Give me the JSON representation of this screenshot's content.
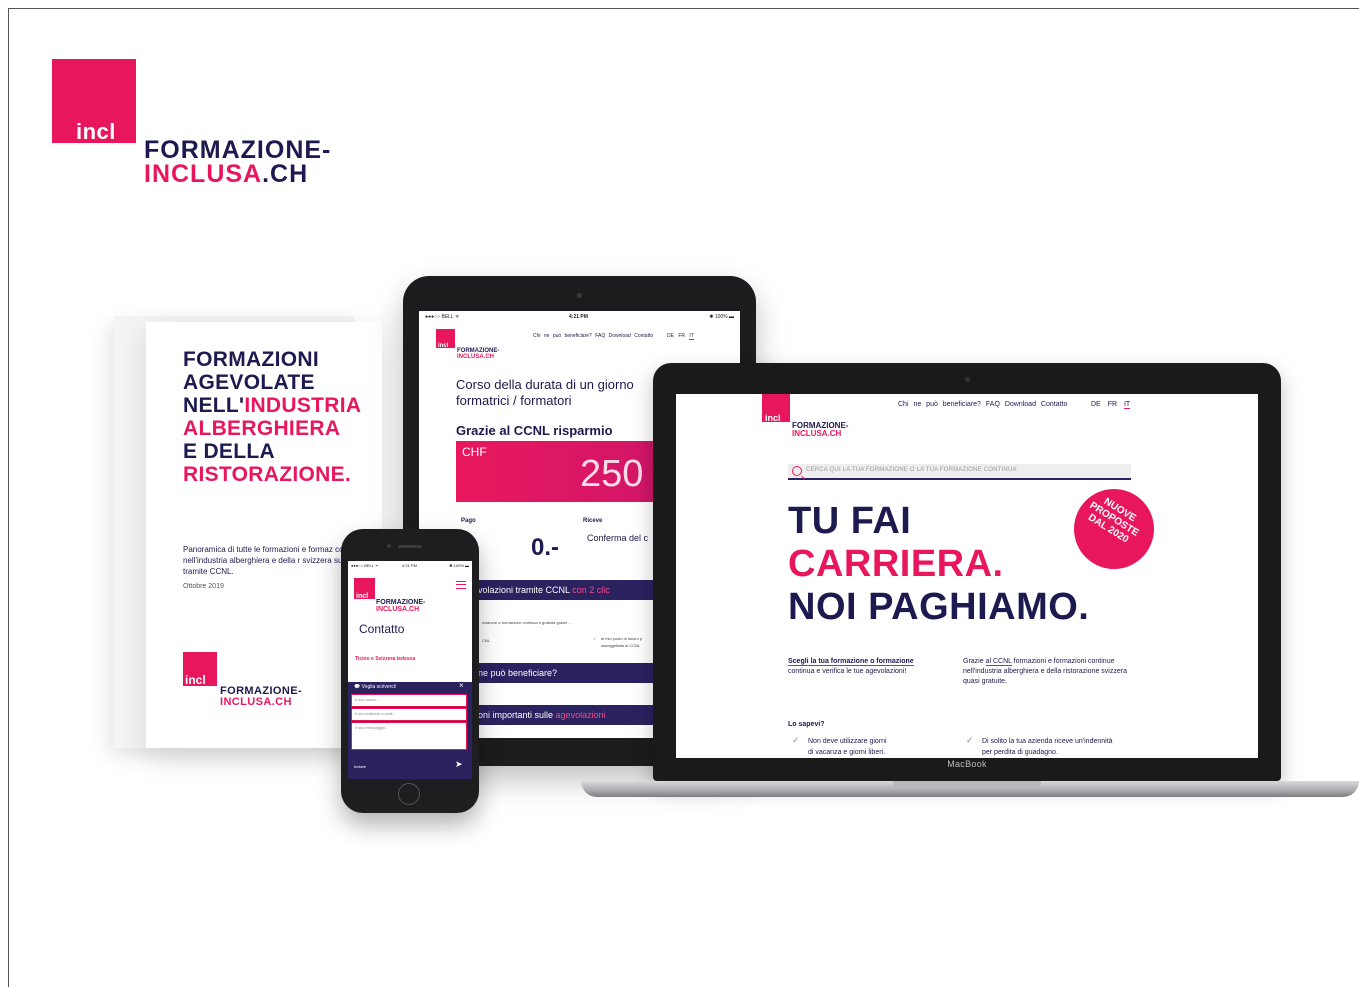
{
  "brand": {
    "square_text": "incl",
    "line1": "FORMAZIONE-",
    "line2_pink": "INCLUSA",
    "line2_rest": ".CH"
  },
  "brochure": {
    "headline": {
      "l1": "FORMAZIONI",
      "l2": "AGEVOLATE",
      "l3a": "NELL'",
      "l3b": "INDUSTRIA",
      "l4": "ALBERGHIERA",
      "l5": "E DELLA",
      "l6": "RISTORAZIONE."
    },
    "text": "Panoramica di tutte le formazioni e formaz continue nell'industria alberghiera e della r svizzera sussidiate tramite CCNL.",
    "date": "Ottobre 2019",
    "logo_square": "incl",
    "logo_l1": "FORMAZIONE-",
    "logo_l2": "INCLUSA.CH"
  },
  "tablet": {
    "status_left": "●●●○○ BELL ᯤ",
    "status_time": "4:21 PM",
    "status_right": "✱ 100% ▬",
    "logo_square": "incl",
    "logo_l1": "FORMAZIONE-",
    "logo_l2": "INCLUSA.CH",
    "nav": "Chi ne può beneficiare?   FAQ   Download   Contatto",
    "lang_de": "DE",
    "lang_fr": "FR",
    "lang_it": "IT",
    "course_l1": "Corso della durata di un giorno",
    "course_l2": "formatrici / formatori",
    "grazie": "Grazie al CCNL risparmio",
    "currency": "CHF",
    "amount": "250",
    "pago": "Pago",
    "riceve": "Riceve",
    "zero": "0.-",
    "conferma": "Conferma del c",
    "bar1_a": "volazioni tramite CCNL",
    "bar1_b": " con 2 clic",
    "small1": "mazione o formazione continua è gratuita grazie ...",
    "small2": "CNL",
    "small3": "al mio posto di lavoro p",
    "small4": "assoggettata al CCNL",
    "bar2": "ne può beneficiare?",
    "bar3_a": "oni importanti sulle ",
    "bar3_b": "agevolazioni"
  },
  "laptop": {
    "label": "MacBook",
    "logo_square": "incl",
    "logo_l1": "FORMAZIONE-",
    "logo_l2": "INCLUSA.CH",
    "nav": "Chi ne può beneficiare?   FAQ   Download   Contatto",
    "lang_de": "DE",
    "lang_fr": "FR",
    "lang_it": "IT",
    "search_placeholder": "CERCA QUI LA TUA FORMAZIONE O LA TUA FORMAZIONE CONTINUA",
    "hero_l1": "TU FAI",
    "hero_l2": "CARRIERA.",
    "hero_l3": "NOI PAGHIAMO.",
    "badge_l1": "NUOVE",
    "badge_l2": "PROPOSTE",
    "badge_l3": "DAL 2020",
    "col1_u": "Scegli la tua formazione o formazione",
    "col1_rest": "continua e verifica le tue agevolazioni!",
    "col2_a": "Grazie ",
    "col2_u": "al CCNL",
    "col2_b": " formazioni e formazioni continue nell'industria alberghiera e della ristorazione svizzera quasi gratuite.",
    "sapevi": "Lo sapevi?",
    "check1_l1": "Non deve utilizzare giorni",
    "check1_l2": "di vacanza e giorni liberi.",
    "check2_l1": "Di solito la tua azienda riceve un'indennità",
    "check2_l2": "per perdita di guadagno."
  },
  "phone": {
    "status_left": "●●●○○ BELL ᯤ",
    "status_time": "4:21 PM",
    "status_right": "✱ 100% ▬",
    "logo_square": "incl",
    "logo_l1": "FORMAZIONE-",
    "logo_l2": "INCLUSA.CH",
    "title": "Contatto",
    "sub": "Ticino e Svizzera tedesca",
    "form_head": "Voglia scriverci!",
    "field1": "Il suo nome...",
    "field2": "Il suo indirizzo e-mail...",
    "field3": "Il suo messaggio...",
    "send": "Inviare"
  },
  "colors": {
    "accent": "#e8175d",
    "navy": "#1d1a4f",
    "bar": "#2b2260"
  }
}
